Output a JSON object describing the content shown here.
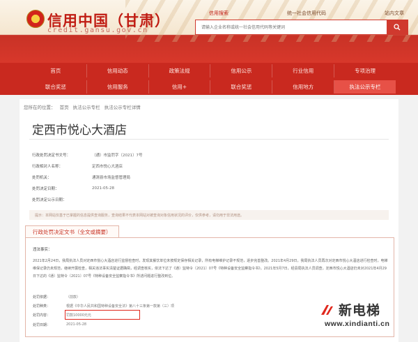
{
  "header": {
    "title": "信用中国（甘肃）",
    "domain": "credit.gansu.gov.cn",
    "top_tabs": [
      "信用搜索",
      "统一社会信用代码",
      "站内文章"
    ],
    "search_placeholder": "请输入企业名称或统一社会信用代码等关键词",
    "search_icon": "search-icon"
  },
  "nav": {
    "row1": [
      "首页",
      "信用动态",
      "政策法规",
      "信用公示",
      "行业信用",
      "专项治理"
    ],
    "row2": [
      "联合奖惩",
      "信用服务",
      "信用+",
      "联合奖惩",
      "信用地方",
      "执法公示专栏"
    ]
  },
  "breadcrumb": [
    "您所在的位置：",
    "首页",
    "执法公示专栏",
    "执法公示专栏详情"
  ],
  "page_title": "定西市悦心大酒店",
  "fields": [
    {
      "label": "行政处罚决定书文号：",
      "value": "（通）市监罚字〔2021〕7号"
    },
    {
      "label": "行政相对人名称：",
      "value": "定西市悦心大酒店"
    },
    {
      "label": "处罚机关：",
      "value": "通渭县市场监督管理局"
    },
    {
      "label": "处罚决定日期：",
      "value": "2021-05-28"
    },
    {
      "label": "处罚决定公示日期：",
      "value": ""
    }
  ],
  "notice": "提示：本网站仅基于已掌握的信息提供查询服务，查询结果不代表本网站对被查询对象信用状况的评价，仅供参考，请勿用于非法用途。",
  "section_title": "行政处罚决定文书（全文或摘要）",
  "body": {
    "label": "违法事实：",
    "text": "2021年2月24日，我局执法人员对定西市悦心大酒店进行监督检查时，发现其餐饮单位未按规定保存相关记录，所有电梯维护记录不规范，逐步完善整改。2021年4月29日，我局执法人员再次对定西市悦心大酒店进行检查时，电梯维保记录仍未规范，继续开展检查，相关违法事实清楚证据确凿，经调查核实，依法下达了《通〕监特令〔2021〕07号《特种设备安全监察指令书》。2021年5月7日，经县局执法人员调查，定西市悦心大酒店仍未对2021年4月29日下达的《通〕监特令〔2021〕07号《特种设备安全监察指令书》所述问题进行整改到位。",
    "rows": [
      {
        "label": "处罚依据：",
        "value": "（前款）"
      },
      {
        "label": "处罚种类：",
        "value": "根据《中华人民共和国特种设备安全法》第八十三条第一款第（三）项"
      },
      {
        "label": "处罚内容：",
        "value": "罚款10000元元"
      },
      {
        "label": "处罚日期：",
        "value": "2021-05-28"
      }
    ]
  },
  "watermark": {
    "name": "新电梯",
    "url": "www.xindianti.cn"
  },
  "colors": {
    "brand_red": "#c9291f",
    "title_red": "#c01c13",
    "highlight": "#e0271c"
  }
}
